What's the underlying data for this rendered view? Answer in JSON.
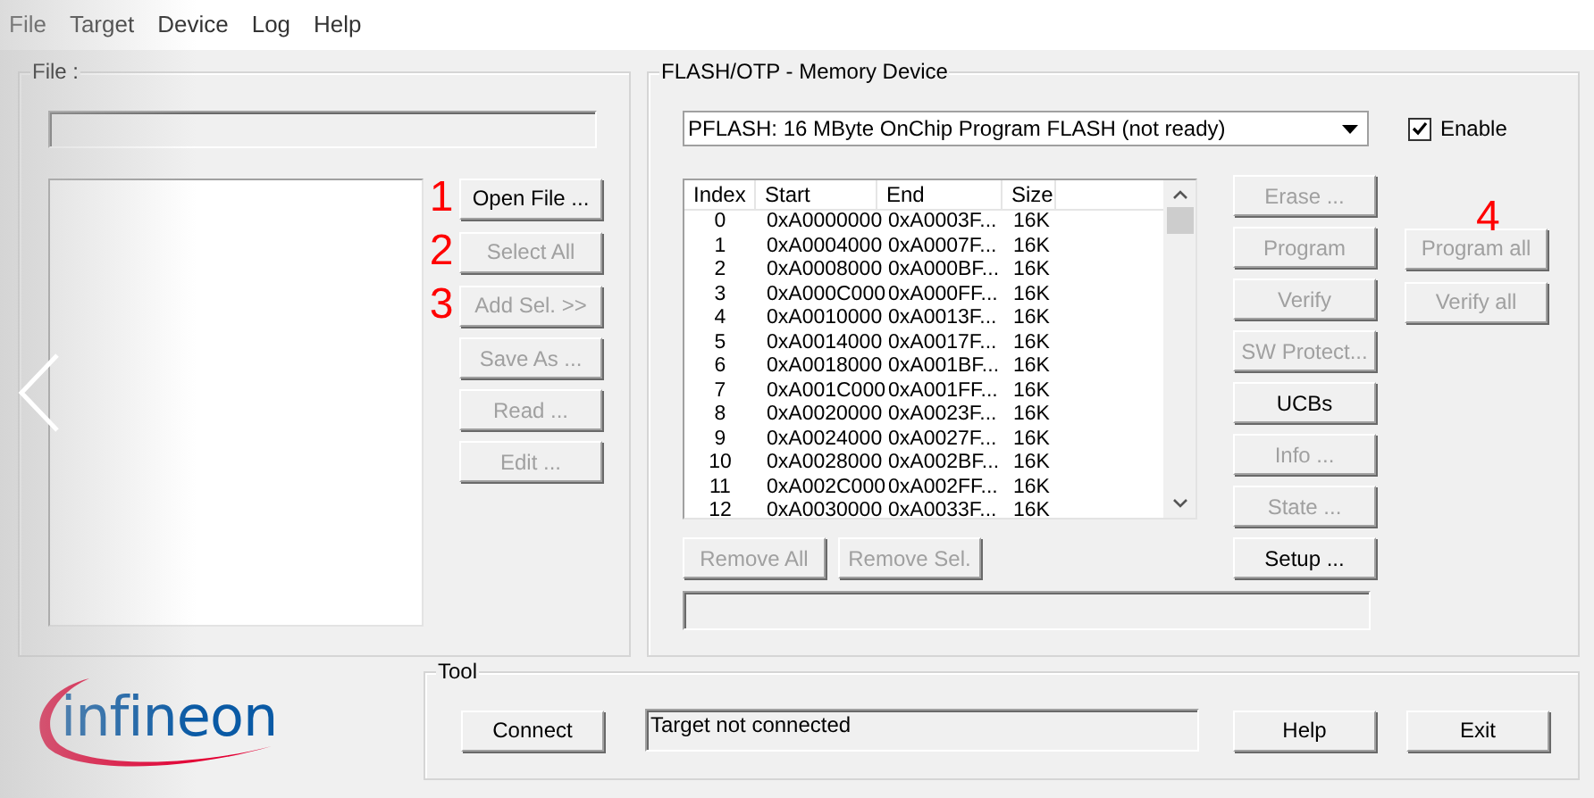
{
  "menu": [
    "File",
    "Target",
    "Device",
    "Log",
    "Help"
  ],
  "file_group": {
    "title": "File :",
    "buttons": [
      {
        "label": "Open File ...",
        "disabled": false,
        "annotation": "1"
      },
      {
        "label": "Select All",
        "disabled": true,
        "annotation": "2"
      },
      {
        "label": "Add Sel. >>",
        "disabled": true,
        "annotation": "3"
      },
      {
        "label": "Save As ...",
        "disabled": true
      },
      {
        "label": "Read ...",
        "disabled": true
      },
      {
        "label": "Edit ...",
        "disabled": true
      }
    ]
  },
  "flash_group": {
    "title": "FLASH/OTP - Memory Device",
    "device_select": "PFLASH: 16 MByte OnChip Program FLASH  (not ready)",
    "enable": {
      "label": "Enable",
      "checked": true
    },
    "table": {
      "columns": [
        "Index",
        "Start",
        "End",
        "Size"
      ],
      "rows": [
        [
          "0",
          "0xA0000000",
          "0xA0003F...",
          "16K"
        ],
        [
          "1",
          "0xA0004000",
          "0xA0007F...",
          "16K"
        ],
        [
          "2",
          "0xA0008000",
          "0xA000BF...",
          "16K"
        ],
        [
          "3",
          "0xA000C000",
          "0xA000FF...",
          "16K"
        ],
        [
          "4",
          "0xA0010000",
          "0xA0013F...",
          "16K"
        ],
        [
          "5",
          "0xA0014000",
          "0xA0017F...",
          "16K"
        ],
        [
          "6",
          "0xA0018000",
          "0xA001BF...",
          "16K"
        ],
        [
          "7",
          "0xA001C000",
          "0xA001FF...",
          "16K"
        ],
        [
          "8",
          "0xA0020000",
          "0xA0023F...",
          "16K"
        ],
        [
          "9",
          "0xA0024000",
          "0xA0027F...",
          "16K"
        ],
        [
          "10",
          "0xA0028000",
          "0xA002BF...",
          "16K"
        ],
        [
          "11",
          "0xA002C000",
          "0xA002FF...",
          "16K"
        ],
        [
          "12",
          "0xA0030000",
          "0xA0033F...",
          "16K"
        ]
      ]
    },
    "actions": [
      {
        "label": "Erase ...",
        "disabled": true
      },
      {
        "label": "Program",
        "disabled": true
      },
      {
        "label": "Verify",
        "disabled": true
      },
      {
        "label": "SW Protect...",
        "disabled": true
      },
      {
        "label": "UCBs",
        "disabled": false
      },
      {
        "label": "Info ...",
        "disabled": true
      },
      {
        "label": "State ...",
        "disabled": true
      },
      {
        "label": "Setup ...",
        "disabled": false
      }
    ],
    "all_actions": [
      {
        "label": "Program all",
        "disabled": true,
        "annotation": "4"
      },
      {
        "label": "Verify all",
        "disabled": true
      }
    ],
    "list_buttons": [
      {
        "label": "Remove All",
        "disabled": true
      },
      {
        "label": "Remove Sel.",
        "disabled": true
      }
    ]
  },
  "logo": {
    "text": "infineon"
  },
  "tool_group": {
    "title": "Tool",
    "connect": {
      "label": "Connect",
      "disabled": false
    },
    "status": "Target not connected",
    "buttons": [
      {
        "label": "Help",
        "disabled": false
      },
      {
        "label": "Exit",
        "disabled": false
      }
    ]
  }
}
